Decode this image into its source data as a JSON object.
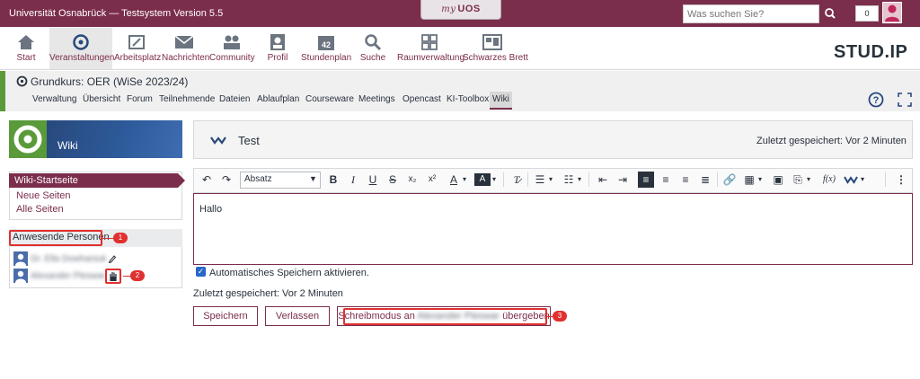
{
  "topbar": {
    "title": "Universität Osnabrück — Testsystem Version 5.5",
    "logo_prefix": "my",
    "logo": "UOS",
    "search_placeholder": "Was suchen Sie?",
    "notification_count": "0"
  },
  "mainnav": {
    "items": [
      {
        "label": "Start",
        "icon": "home-icon"
      },
      {
        "label": "Veranstaltungen",
        "icon": "courses-icon"
      },
      {
        "label": "Arbeitsplatz",
        "icon": "workplace-icon"
      },
      {
        "label": "Nachrichten",
        "icon": "mail-icon"
      },
      {
        "label": "Community",
        "icon": "community-icon"
      },
      {
        "label": "Profil",
        "icon": "profile-icon"
      },
      {
        "label": "Stundenplan",
        "icon": "schedule-icon"
      },
      {
        "label": "Suche",
        "icon": "search-icon"
      },
      {
        "label": "Raumverwaltung",
        "icon": "room-icon"
      },
      {
        "label": "Schwarzes Brett",
        "icon": "board-icon"
      }
    ],
    "brand": "STUD.IP"
  },
  "course": {
    "title": "Grundkurs: OER (WiSe 2023/24)",
    "tabs": [
      "Verwaltung",
      "Übersicht",
      "Forum",
      "Teilnehmende",
      "Dateien",
      "Ablaufplan",
      "Courseware",
      "Meetings",
      "Opencast",
      "KI-Toolbox",
      "Wiki"
    ],
    "active_tab": "Wiki"
  },
  "sidebar": {
    "header": "Wiki",
    "nav": [
      "Wiki-Startseite",
      "Neue Seiten",
      "Alle Seiten"
    ],
    "presence_title": "Anwesende Personen",
    "persons": [
      "Dr. Ella Dowhaniuk",
      "Alexander Pleswar"
    ]
  },
  "badges": [
    "1",
    "2",
    "3"
  ],
  "wiki": {
    "page_title": "Test",
    "saved_status": "Zuletzt gespeichert: Vor 2 Minuten",
    "paragraph_style": "Absatz",
    "content": "Hallo",
    "autosave_label": "Automatisches Speichern aktivieren.",
    "saved_bottom": "Zuletzt gespeichert: Vor 2 Minuten",
    "buttons": {
      "save": "Speichern",
      "leave": "Verlassen",
      "handover_prefix": "Schreibmodus an",
      "handover_name": "Alexander Pleswar",
      "handover_suffix": "übergeben"
    }
  },
  "colors": {
    "brand": "#7b2d4c",
    "accent_green": "#5a9a3a",
    "badge_red": "#e03030"
  }
}
